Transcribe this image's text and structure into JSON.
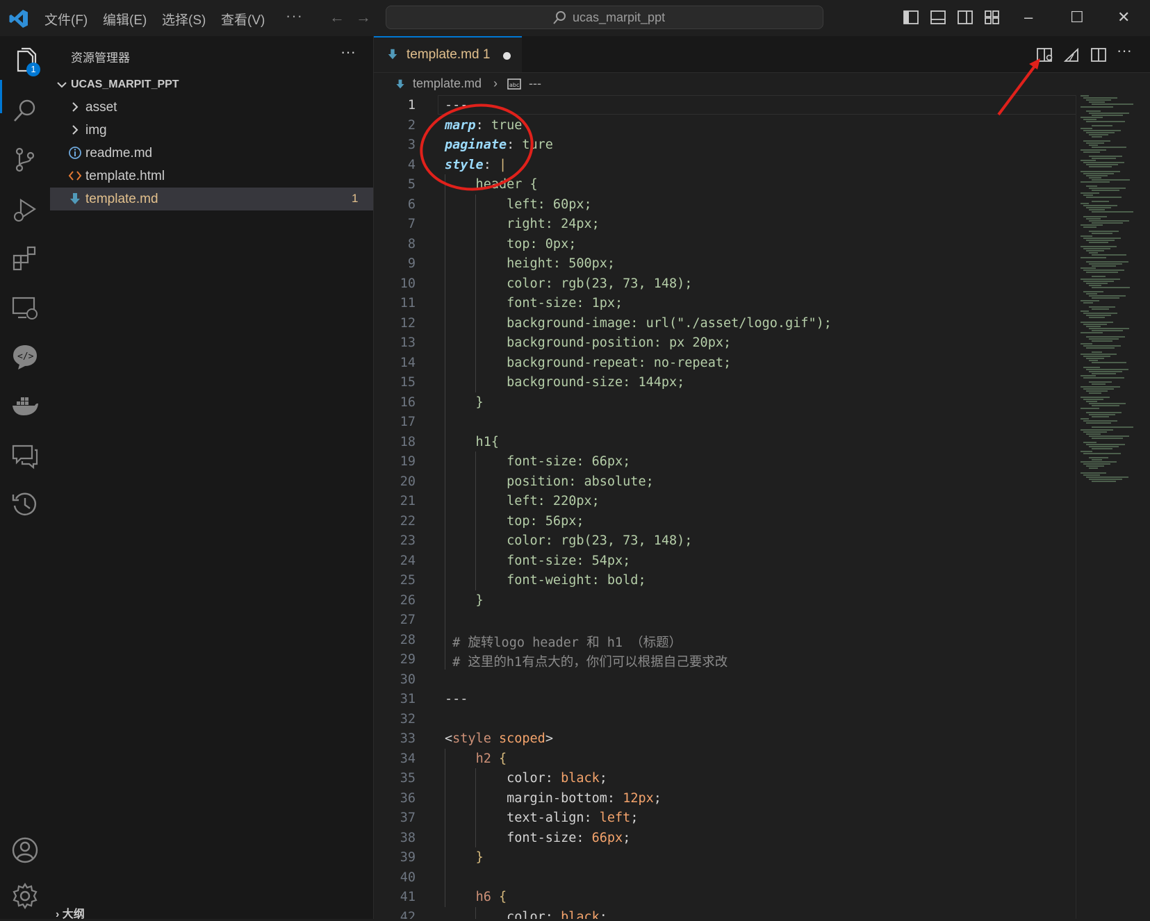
{
  "titlebar": {
    "menus": [
      "文件(F)",
      "编辑(E)",
      "选择(S)",
      "查看(V)"
    ],
    "more": "···",
    "search_text": "ucas_marpit_ppt"
  },
  "activity": {
    "explorer_badge": "1",
    "items": [
      "files-icon",
      "search-icon",
      "source-control-icon",
      "run-debug-icon",
      "extensions-icon",
      "remote-explorer-icon",
      "code-chat-icon",
      "docker-icon",
      "comments-icon",
      "timeline-icon",
      "account-icon",
      "settings-gear-icon"
    ]
  },
  "sidebar": {
    "title": "资源管理器",
    "more": "···",
    "root_folder": "UCAS_MARPIT_PPT",
    "items": [
      {
        "label": "asset",
        "type": "folder"
      },
      {
        "label": "img",
        "type": "folder"
      },
      {
        "label": "readme.md",
        "type": "info"
      },
      {
        "label": "template.html",
        "type": "html"
      },
      {
        "label": "template.md",
        "type": "markdown",
        "count": "1"
      }
    ],
    "outline": "大纲"
  },
  "editor": {
    "tab_label": "template.md 1",
    "breadcrumb_file": "template.md",
    "breadcrumb_symbol": "---",
    "active_line": 1
  },
  "code": {
    "line_numbers": [
      "1",
      "2",
      "3",
      "4",
      "5",
      "6",
      "7",
      "8",
      "9",
      "10",
      "11",
      "12",
      "13",
      "14",
      "15",
      "16",
      "17",
      "18",
      "19",
      "20",
      "21",
      "22",
      "23",
      "24",
      "25",
      "26",
      "27",
      "28",
      "29",
      "30",
      "31",
      "32",
      "33",
      "34",
      "35",
      "36",
      "37",
      "38",
      "39",
      "40",
      "41",
      "42"
    ],
    "lines": [
      [
        {
          "c": "p",
          "t": "---"
        }
      ],
      [
        {
          "c": "k",
          "t": "marp"
        },
        {
          "c": "p",
          "t": ": "
        },
        {
          "c": "g",
          "t": "true"
        }
      ],
      [
        {
          "c": "k",
          "t": "paginate"
        },
        {
          "c": "p",
          "t": ": "
        },
        {
          "c": "g",
          "t": "ture"
        }
      ],
      [
        {
          "c": "k",
          "t": "style"
        },
        {
          "c": "p",
          "t": ": "
        },
        {
          "c": "y",
          "t": "|"
        }
      ],
      [
        {
          "c": "g",
          "t": "    header {"
        }
      ],
      [
        {
          "c": "g",
          "t": "        left: 60px;"
        }
      ],
      [
        {
          "c": "g",
          "t": "        right: 24px;"
        }
      ],
      [
        {
          "c": "g",
          "t": "        top: 0px;"
        }
      ],
      [
        {
          "c": "g",
          "t": "        height: 500px;"
        }
      ],
      [
        {
          "c": "g",
          "t": "        color: rgb(23, 73, 148);"
        }
      ],
      [
        {
          "c": "g",
          "t": "        font-size: 1px;"
        }
      ],
      [
        {
          "c": "g",
          "t": "        background-image: url(\"./asset/logo.gif\");"
        }
      ],
      [
        {
          "c": "g",
          "t": "        background-position: px 20px;"
        }
      ],
      [
        {
          "c": "g",
          "t": "        background-repeat: no-repeat;"
        }
      ],
      [
        {
          "c": "g",
          "t": "        background-size: 144px;"
        }
      ],
      [
        {
          "c": "g",
          "t": "    }"
        }
      ],
      [
        {
          "c": "g",
          "t": ""
        }
      ],
      [
        {
          "c": "g",
          "t": "    h1{"
        }
      ],
      [
        {
          "c": "g",
          "t": "        font-size: 66px;"
        }
      ],
      [
        {
          "c": "g",
          "t": "        position: absolute;"
        }
      ],
      [
        {
          "c": "g",
          "t": "        left: 220px;"
        }
      ],
      [
        {
          "c": "g",
          "t": "        top: 56px;"
        }
      ],
      [
        {
          "c": "g",
          "t": "        color: rgb(23, 73, 148);"
        }
      ],
      [
        {
          "c": "g",
          "t": "        font-size: 54px;"
        }
      ],
      [
        {
          "c": "g",
          "t": "        font-weight: bold;"
        }
      ],
      [
        {
          "c": "g",
          "t": "    }"
        }
      ],
      [
        {
          "c": "g",
          "t": ""
        }
      ],
      [
        {
          "c": "c",
          "t": " # 旋转logo header 和 h1 （标题）"
        }
      ],
      [
        {
          "c": "c",
          "t": " # 这里的h1有点大的，你们可以根据自己要求改"
        }
      ],
      [
        {
          "c": "p",
          "t": ""
        }
      ],
      [
        {
          "c": "p",
          "t": "---"
        }
      ],
      [
        {
          "c": "p",
          "t": ""
        }
      ],
      [
        {
          "c": "p",
          "t": "<"
        },
        {
          "c": "t",
          "t": "style"
        },
        {
          "c": "p",
          "t": " "
        },
        {
          "c": "n",
          "t": "scoped"
        },
        {
          "c": "p",
          "t": ">"
        }
      ],
      [
        {
          "c": "p",
          "t": "    "
        },
        {
          "c": "t",
          "t": "h2"
        },
        {
          "c": "p",
          "t": " "
        },
        {
          "c": "y",
          "t": "{"
        }
      ],
      [
        {
          "c": "p",
          "t": "        color: "
        },
        {
          "c": "n",
          "t": "black"
        },
        {
          "c": "p",
          "t": ";"
        }
      ],
      [
        {
          "c": "p",
          "t": "        margin-bottom: "
        },
        {
          "c": "n",
          "t": "12px"
        },
        {
          "c": "p",
          "t": ";"
        }
      ],
      [
        {
          "c": "p",
          "t": "        text-align: "
        },
        {
          "c": "n",
          "t": "left"
        },
        {
          "c": "p",
          "t": ";"
        }
      ],
      [
        {
          "c": "p",
          "t": "        font-size: "
        },
        {
          "c": "n",
          "t": "66px"
        },
        {
          "c": "p",
          "t": ";"
        }
      ],
      [
        {
          "c": "p",
          "t": "    "
        },
        {
          "c": "y",
          "t": "}"
        }
      ],
      [
        {
          "c": "p",
          "t": ""
        }
      ],
      [
        {
          "c": "p",
          "t": "    "
        },
        {
          "c": "t",
          "t": "h6"
        },
        {
          "c": "p",
          "t": " "
        },
        {
          "c": "y",
          "t": "{"
        }
      ],
      [
        {
          "c": "p",
          "t": "        color: "
        },
        {
          "c": "n",
          "t": "black"
        },
        {
          "c": "p",
          "t": ";"
        }
      ]
    ]
  },
  "colors": {
    "accent": "#0078d4",
    "modified": "#e2c08d",
    "annotation_red": "#e0211b"
  }
}
